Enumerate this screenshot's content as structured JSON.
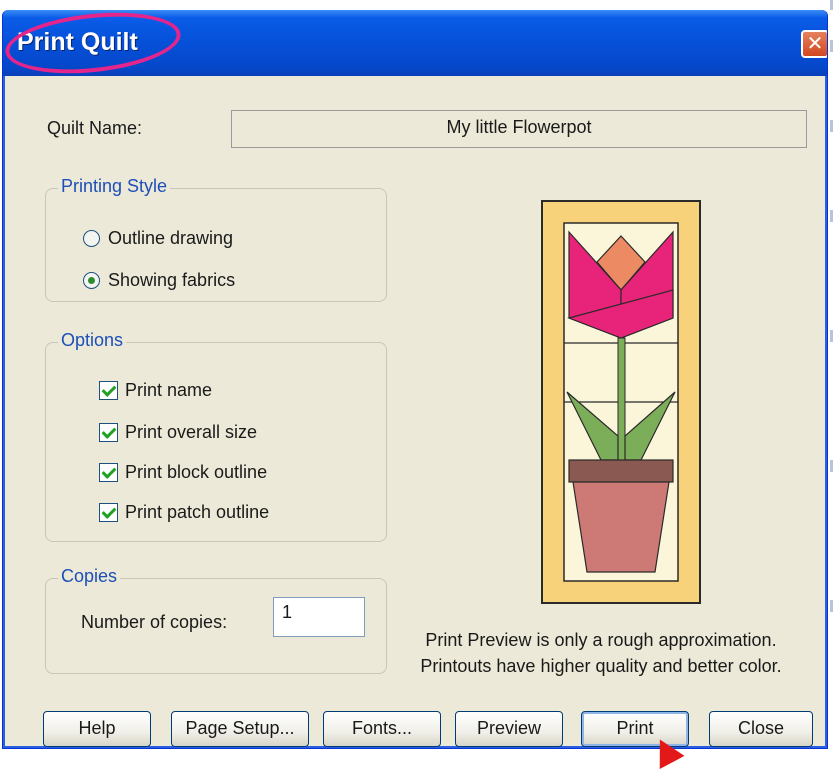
{
  "window": {
    "title": "Print Quilt",
    "close_symbol": "✕"
  },
  "quilt_name": {
    "label": "Quilt Name:",
    "value": "My little Flowerpot"
  },
  "printing_style": {
    "title": "Printing Style",
    "options": [
      {
        "label": "Outline drawing",
        "selected": false
      },
      {
        "label": "Showing fabrics",
        "selected": true
      }
    ]
  },
  "options": {
    "title": "Options",
    "items": [
      {
        "label": "Print name",
        "checked": true
      },
      {
        "label": "Print overall size",
        "checked": true
      },
      {
        "label": "Print block outline",
        "checked": true
      },
      {
        "label": "Print patch outline",
        "checked": true
      }
    ]
  },
  "copies": {
    "title": "Copies",
    "label": "Number of copies:",
    "value": "1"
  },
  "preview": {
    "note_line1": "Print Preview is only a rough approximation.",
    "note_line2": "Printouts have higher quality and better color."
  },
  "buttons": {
    "help": "Help",
    "page_setup": "Page Setup...",
    "fonts": "Fonts...",
    "preview": "Preview",
    "print": "Print",
    "close": "Close"
  },
  "colors": {
    "border_yellow": "#f8d27a",
    "background_cream": "#fbf6da",
    "tulip_pink": "#e8247a",
    "tulip_center": "#ec8a64",
    "leaf_green": "#7cae5a",
    "pot_rim": "#8a5a52",
    "pot_body": "#cd7a76",
    "title_highlight": "#e6258c"
  }
}
